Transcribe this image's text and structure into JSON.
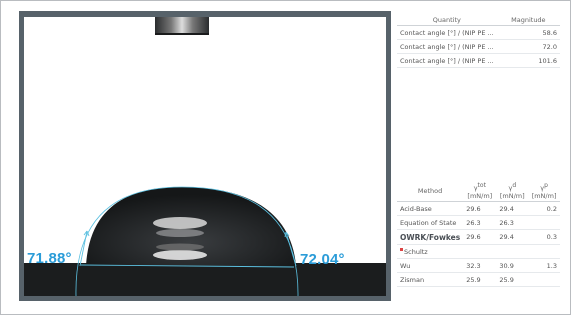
{
  "angles": {
    "left": "71.88°",
    "right": "72.04°"
  },
  "quantity_table": {
    "headers": {
      "quantity": "Quantity",
      "magnitude": "Magnitude"
    },
    "rows": [
      {
        "quantity": "Contact angle [°] / (NIP PE ...",
        "magnitude": "58.6"
      },
      {
        "quantity": "Contact angle [°] / (NIP PE ...",
        "magnitude": "72.0"
      },
      {
        "quantity": "Contact angle [°] / (NIP PE ...",
        "magnitude": "101.6"
      }
    ]
  },
  "method_table": {
    "headers": {
      "method": "Method",
      "col1": "γ",
      "col1_sup": "tot",
      "col1_unit": " [mN/m]",
      "col2": "γ",
      "col2_sup": "d",
      "col2_unit": " [mN/m]",
      "col3": "γ",
      "col3_sup": "p",
      "col3_unit": " [mN/m]"
    },
    "rows": [
      {
        "method": "Acid-Base",
        "v1": "29.6",
        "v2": "29.4",
        "v3": "0.2",
        "style": "normal"
      },
      {
        "method": "Equation of State",
        "v1": "26.3",
        "v2": "26.3",
        "v3": "",
        "style": "normal"
      },
      {
        "method": "OWRK/Fowkes",
        "v1": "29.6",
        "v2": "29.4",
        "v3": "0.3",
        "style": "bold"
      },
      {
        "method": "Schultz",
        "v1": "",
        "v2": "",
        "v3": "",
        "style": "flagged"
      },
      {
        "method": "Wu",
        "v1": "32.3",
        "v2": "30.9",
        "v3": "1.3",
        "style": "normal"
      },
      {
        "method": "Zisman",
        "v1": "25.9",
        "v2": "25.9",
        "v3": "",
        "style": "normal"
      }
    ]
  },
  "colors": {
    "accent": "#2b9cd8",
    "fit_line": "#5cc0e0",
    "frame": "#57626a",
    "drop": "#1f2224"
  }
}
